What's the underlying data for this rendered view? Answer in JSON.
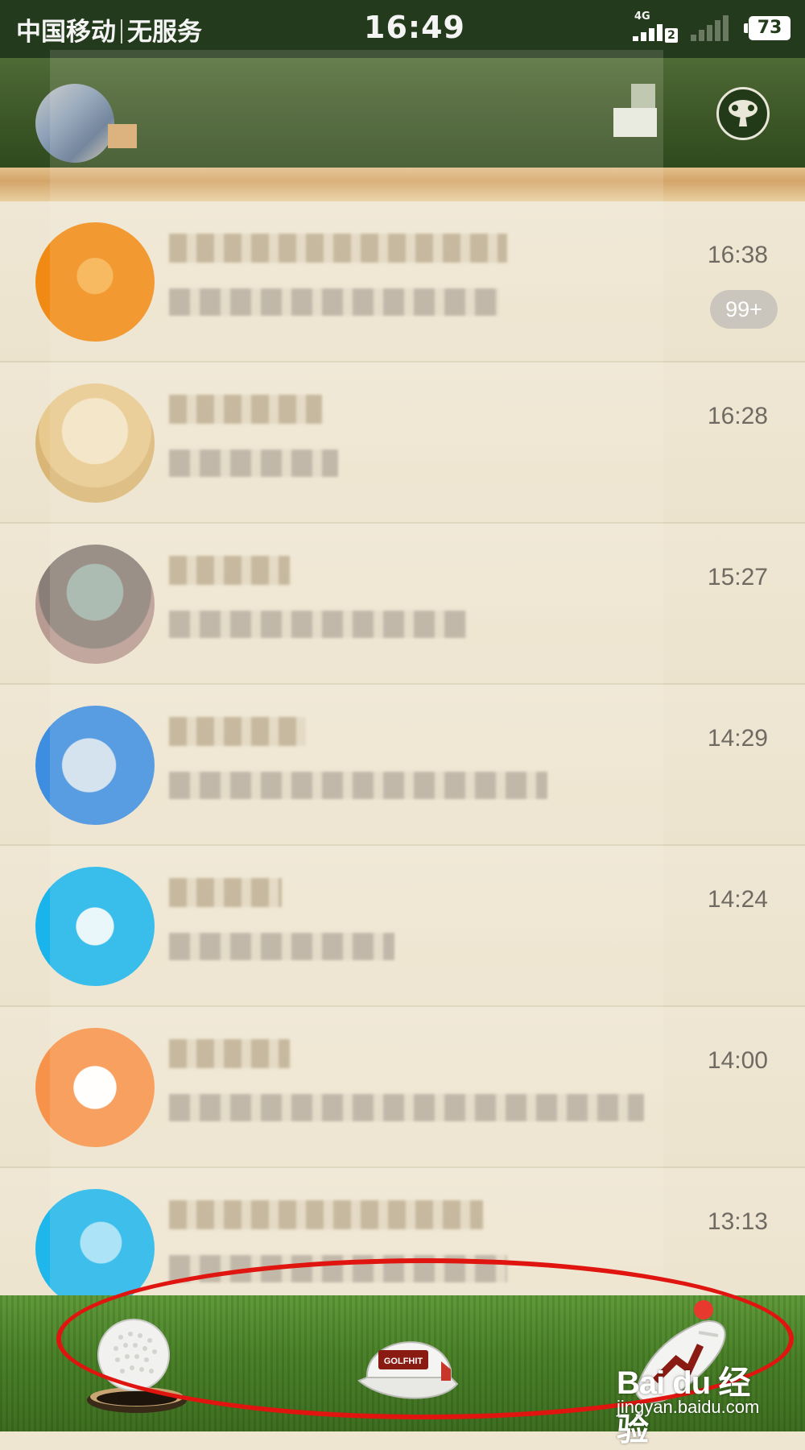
{
  "status_bar": {
    "carrier": "中国移动",
    "service": "无服务",
    "time": "16:49",
    "network_tag": "4G",
    "sim_number": "2",
    "battery": "73"
  },
  "header": {
    "title": "",
    "avatar_icon": "user-avatar",
    "compose_icon": "compose-icon",
    "club_icon": "golf-club-logo-icon"
  },
  "conversations": [
    {
      "time": "16:38",
      "unread": "99+",
      "avatar_color": "#f08a14"
    },
    {
      "time": "16:28",
      "unread": "",
      "avatar_color": "#e9d2a6"
    },
    {
      "time": "15:27",
      "unread": "",
      "avatar_color": "#8a9a86"
    },
    {
      "time": "14:29",
      "unread": "",
      "avatar_color": "#3d8ee0"
    },
    {
      "time": "14:24",
      "unread": "",
      "avatar_color": "#19b4ec"
    },
    {
      "time": "14:00",
      "unread": "",
      "avatar_color": "#f6924a"
    },
    {
      "time": "13:13",
      "unread": "",
      "avatar_color": "#1fb6ec"
    }
  ],
  "tabbar": {
    "tabs": [
      {
        "icon": "golf-ball-icon"
      },
      {
        "icon": "golf-cap-icon",
        "cap_text": "GOLFHIT"
      },
      {
        "icon": "golf-shoe-icon",
        "has_notification": true
      }
    ],
    "accent": "#e8392e"
  },
  "watermark": {
    "logo": "Bai du 经验",
    "site": "jingyan.baidu.com"
  }
}
